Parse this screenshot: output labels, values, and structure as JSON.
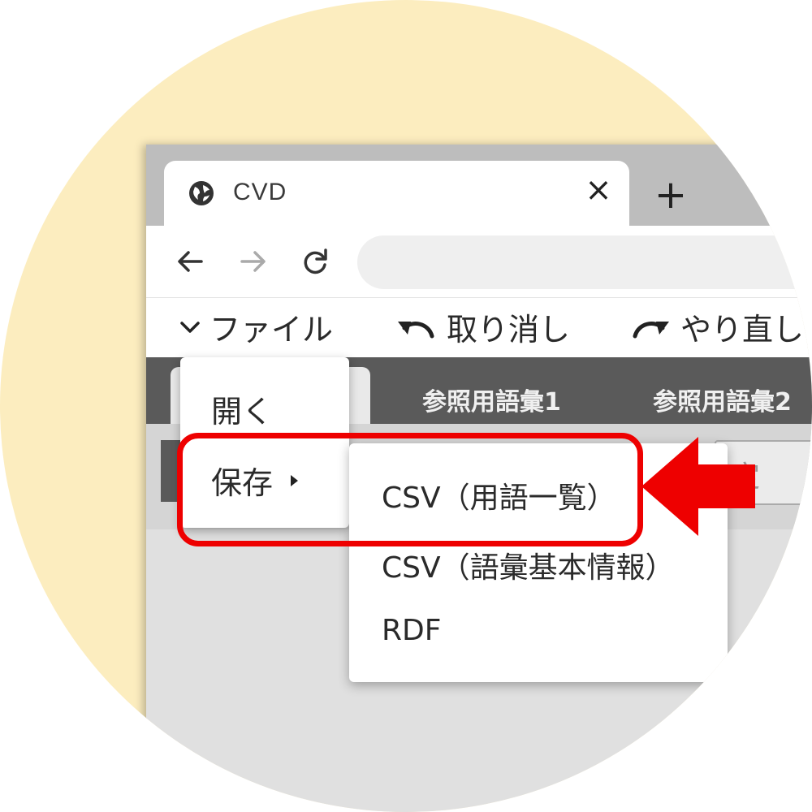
{
  "tab": {
    "title": "CVD",
    "close": "×",
    "icon": "globe-icon"
  },
  "new_tab": "+",
  "nav": {
    "back_icon": "arrow-left-icon",
    "forward_icon": "arrow-right-icon",
    "reload_icon": "reload-icon"
  },
  "toolbar": {
    "file_label": "ファイル",
    "undo_label": "取り消し",
    "redo_label": "やり直し"
  },
  "vocab_tabs": [
    "参照用語彙1",
    "参照用語彙2"
  ],
  "subbar_text": "定",
  "file_menu": {
    "open": "開く",
    "save": "保存"
  },
  "save_submenu": [
    "CSV（用語一覧）",
    "CSV（語彙基本情報）",
    "RDF"
  ],
  "colors": {
    "highlight": "#ee0000",
    "circle_bg": "#fcedbf"
  }
}
